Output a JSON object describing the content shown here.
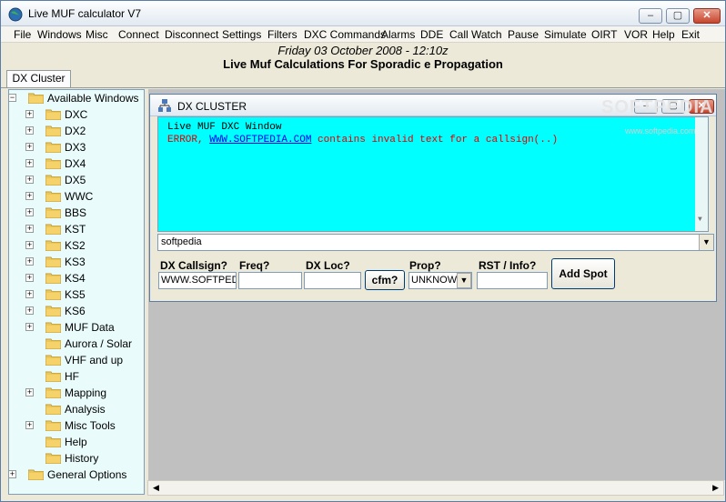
{
  "app": {
    "title": "Live MUF calculator V7"
  },
  "menu": [
    "File",
    "Windows",
    "Misc",
    "Connect",
    "Disconnect",
    "Settings",
    "Filters",
    "DXC Commands",
    "Alarms",
    "DDE",
    "Call Watch",
    "Pause",
    "Simulate",
    "OIRT",
    "VOR",
    "Help",
    "Exit"
  ],
  "header": {
    "datetime": "Friday 03 October 2008 - 12:10z",
    "heading": "Live Muf Calculations For Sporadic e Propagation"
  },
  "tab": {
    "label": "DX Cluster"
  },
  "tree": {
    "root": "Available Windows",
    "items": [
      "DXC",
      "DX2",
      "DX3",
      "DX4",
      "DX5",
      "WWC",
      "BBS",
      "KST",
      "KS2",
      "KS3",
      "KS4",
      "KS5",
      "KS6",
      "MUF Data",
      "Aurora / Solar",
      "VHF and up",
      "HF",
      "Mapping",
      "Analysis",
      "Misc Tools",
      "Help",
      "History"
    ],
    "last": "General Options"
  },
  "dx": {
    "title": "DX CLUSTER",
    "line1": "Live MUF DXC Window",
    "line2_prefix": "ERROR, ",
    "line2_link": "WWW.SOFTPEDIA.COM",
    "line2_suffix": " contains invalid text for a callsign(..)",
    "combo_value": "softpedia",
    "labels": {
      "callsign": "DX Callsign?",
      "freq": "Freq?",
      "loc": "DX Loc?",
      "prop": "Prop?",
      "rst": "RST / Info?"
    },
    "values": {
      "callsign": "WWW.SOFTPEDIA",
      "freq": "",
      "loc": "",
      "prop": "UNKNOWN",
      "rst": ""
    },
    "cfm_label": "cfm?",
    "addspot_label": "Add Spot"
  },
  "watermark": {
    "main": "SOFTPEDIA",
    "url": "www.softpedia.com"
  }
}
